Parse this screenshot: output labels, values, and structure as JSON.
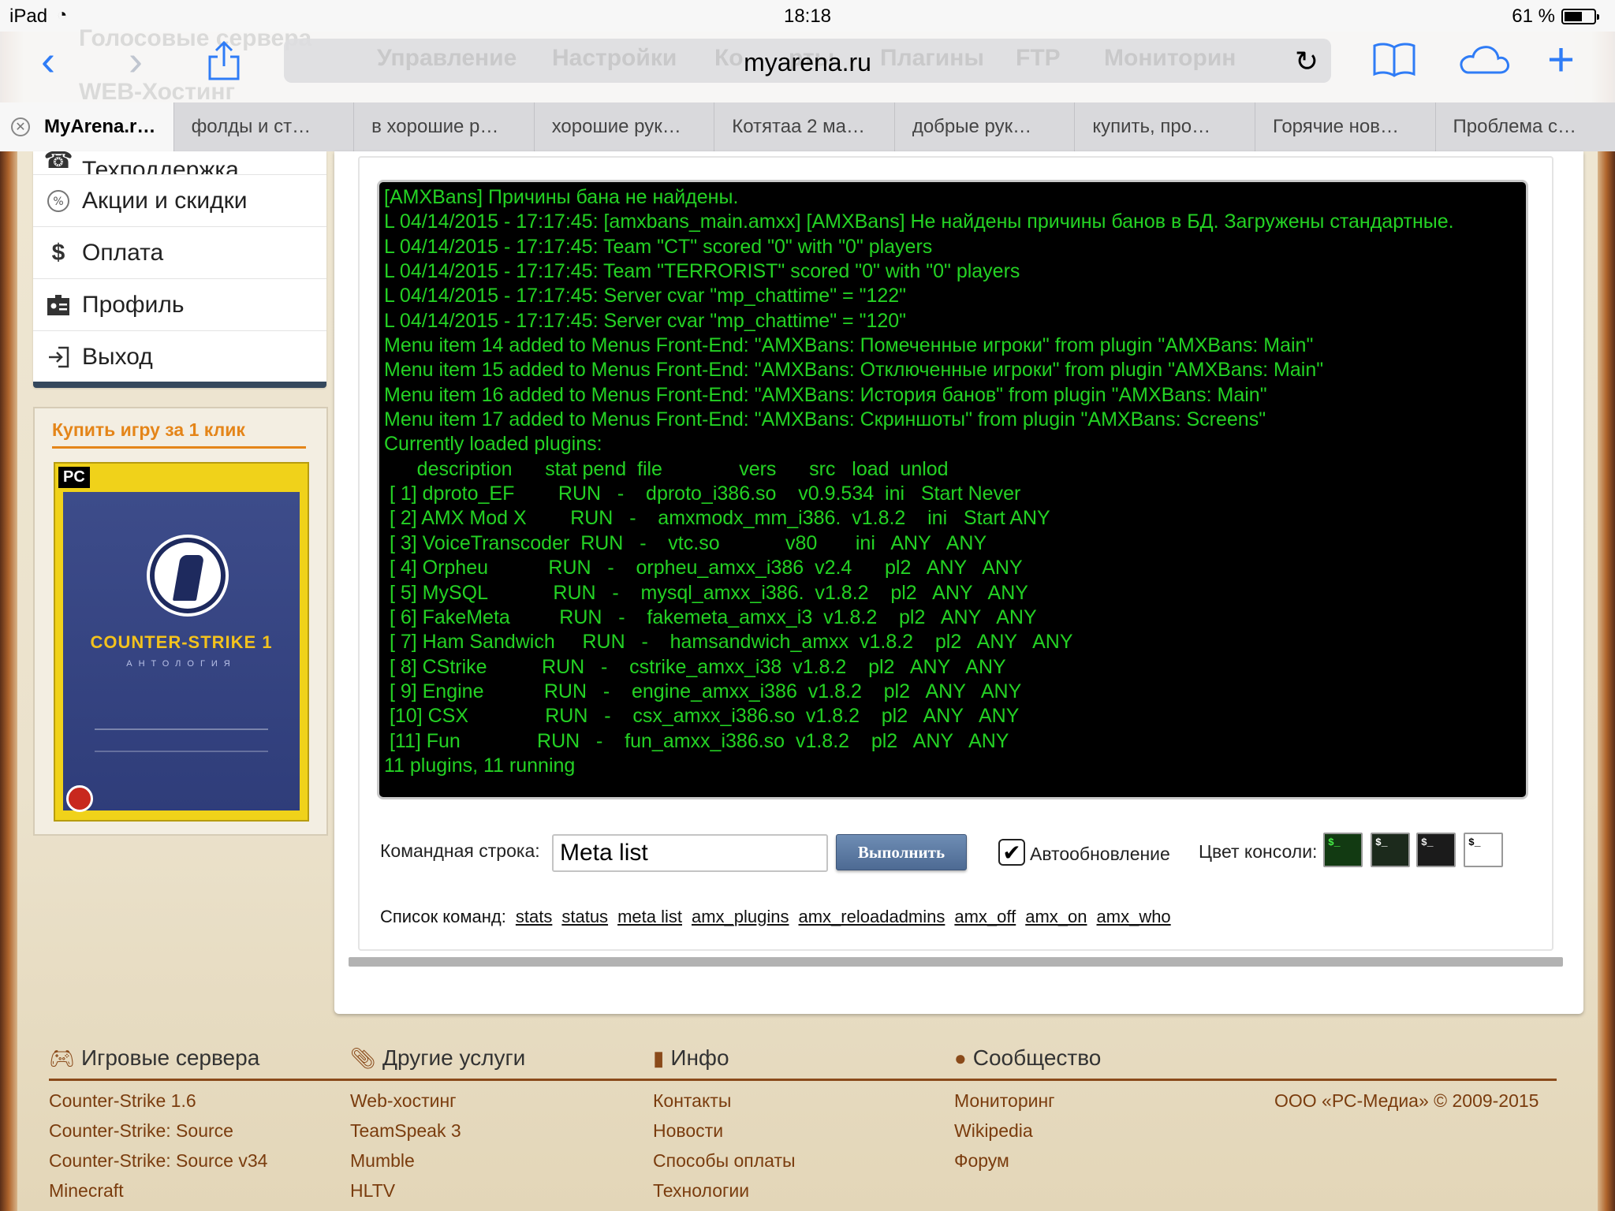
{
  "status_bar": {
    "device": "iPad",
    "time": "18:18",
    "battery": "61 %"
  },
  "browser": {
    "url": "myarena.ru",
    "ghost_menu": [
      "Управление",
      "Настройки",
      "Ко",
      "рты",
      "Плагины",
      "FTP",
      "Мониторин"
    ],
    "ghost_side": [
      "Голосовые сервера",
      "WEB-Хостинг"
    ],
    "tabs": [
      {
        "label": "MyArena.r…",
        "active": true
      },
      {
        "label": "фолды и ст…"
      },
      {
        "label": "в хорошие р…"
      },
      {
        "label": "хорошие рук…"
      },
      {
        "label": "Котятаа 2 ма…"
      },
      {
        "label": "добрые рук…"
      },
      {
        "label": "купить, про…"
      },
      {
        "label": "Горячие нов…"
      },
      {
        "label": "Проблема с…"
      }
    ]
  },
  "sidebar": {
    "items": [
      {
        "label": "Техподдержка",
        "icon": "support-icon"
      },
      {
        "label": "Акции и скидки",
        "icon": "percent-icon"
      },
      {
        "label": "Оплата",
        "icon": "dollar-icon"
      },
      {
        "label": "Профиль",
        "icon": "profile-icon"
      },
      {
        "label": "Выход",
        "icon": "logout-icon"
      }
    ],
    "promo": {
      "title": "Купить игру за 1 клик",
      "box_label": "PC",
      "box_title": "COUNTER-STRIKE 1",
      "box_subtitle": "АНТОЛОГИЯ"
    }
  },
  "console": {
    "lines": [
      "[AMXBans] Причины бана не найдены.",
      "L 04/14/2015 - 17:17:45: [amxbans_main.amxx] [AMXBans] Не найдены причины банов в БД. Загружены стандартные.",
      "L 04/14/2015 - 17:17:45: Team \"CT\" scored \"0\" with \"0\" players",
      "L 04/14/2015 - 17:17:45: Team \"TERRORIST\" scored \"0\" with \"0\" players",
      "L 04/14/2015 - 17:17:45: Server cvar \"mp_chattime\" = \"122\"",
      "L 04/14/2015 - 17:17:45: Server cvar \"mp_chattime\" = \"120\"",
      "Menu item 14 added to Menus Front-End: \"AMXBans: Помеченные игроки\" from plugin \"AMXBans: Main\"",
      "Menu item 15 added to Menus Front-End: \"AMXBans: Отключенные игроки\" from plugin \"AMXBans: Main\"",
      "Menu item 16 added to Menus Front-End: \"AMXBans: История банов\" from plugin \"AMXBans: Main\"",
      "Menu item 17 added to Menus Front-End: \"AMXBans: Скриншоты\" from plugin \"AMXBans: Screens\"",
      "Currently loaded plugins:",
      "      description      stat pend  file              vers      src   load  unlod",
      " [ 1] dproto_EF        RUN   -    dproto_i386.so    v0.9.534  ini   Start Never",
      " [ 2] AMX Mod X        RUN   -    amxmodx_mm_i386.  v1.8.2    ini   Start ANY",
      " [ 3] VoiceTranscoder  RUN   -    vtc.so            v80       ini   ANY   ANY",
      " [ 4] Orpheu           RUN   -    orpheu_amxx_i386  v2.4      pl2   ANY   ANY",
      " [ 5] MySQL            RUN   -    mysql_amxx_i386.  v1.8.2    pl2   ANY   ANY",
      " [ 6] FakeMeta         RUN   -    fakemeta_amxx_i3  v1.8.2    pl2   ANY   ANY",
      " [ 7] Ham Sandwich     RUN   -    hamsandwich_amxx  v1.8.2    pl2   ANY   ANY",
      " [ 8] CStrike          RUN   -    cstrike_amxx_i38  v1.8.2    pl2   ANY   ANY",
      " [ 9] Engine           RUN   -    engine_amxx_i386  v1.8.2    pl2   ANY   ANY",
      " [10] CSX              RUN   -    csx_amxx_i386.so  v1.8.2    pl2   ANY   ANY",
      " [11] Fun              RUN   -    fun_amxx_i386.so  v1.8.2    pl2   ANY   ANY",
      "11 plugins, 11 running"
    ],
    "text_color": "#24d224",
    "background": "#000000"
  },
  "command": {
    "label": "Командная строка:",
    "value": "Meta list",
    "run_button": "Выполнить",
    "autoupdate_label": "Автообновление",
    "autoupdate_checked": true,
    "color_label": "Цвет консоли:",
    "swatch_glyph": "$_",
    "list_label": "Список команд:",
    "commands": [
      "stats",
      "status",
      "meta list",
      "amx_plugins",
      "amx_reloadadmins",
      "amx_off",
      "amx_on",
      "amx_who"
    ]
  },
  "footer": {
    "columns": [
      {
        "title": "Игровые сервера",
        "icon": "gamepad-icon",
        "links": [
          "Counter-Strike 1.6",
          "Counter-Strike: Source",
          "Counter-Strike: Source v34",
          "Minecraft"
        ]
      },
      {
        "title": "Другие услуги",
        "icon": "paperclip-icon",
        "links": [
          "Web-хостинг",
          "TeamSpeak 3",
          "Mumble",
          "HLTV"
        ]
      },
      {
        "title": "Инфо",
        "icon": "book-icon",
        "links": [
          "Контакты",
          "Новости",
          "Способы оплаты",
          "Технологии"
        ]
      },
      {
        "title": "Сообщество",
        "icon": "chat-icon",
        "links": [
          "Мониторинг",
          "Wikipedia",
          "Форум"
        ]
      }
    ],
    "copyright": "ООО «РС-Медиа» © 2009-2015"
  }
}
